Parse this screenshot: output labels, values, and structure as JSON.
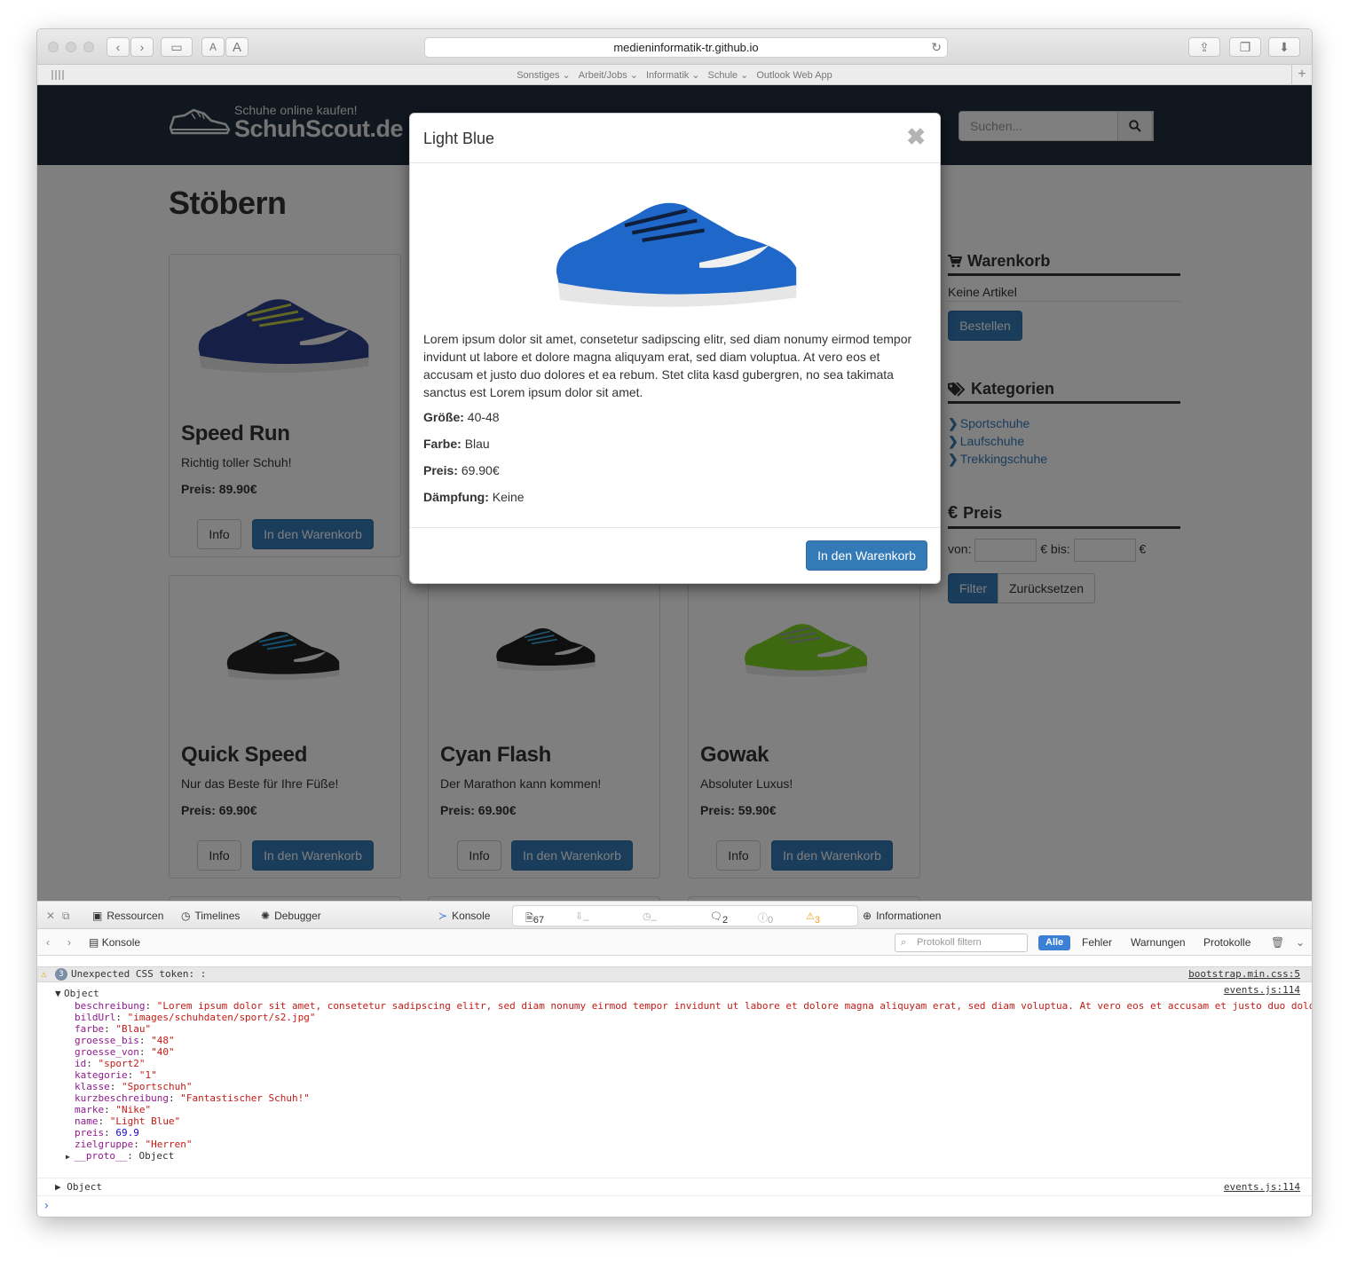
{
  "browser": {
    "url": "medieninformatik-tr.github.io",
    "favorites": [
      "Sonstiges",
      "Arbeit/Jobs",
      "Informatik",
      "Schule",
      "Outlook Web App"
    ],
    "tb_a_small": "A",
    "tb_a_large": "A"
  },
  "site": {
    "tagline": "Schuhe online kaufen!",
    "brand": "SchuhScout.de",
    "search_placeholder": "Suchen...",
    "heading": "Stöbern",
    "info_label": "Info",
    "cart_label": "In den Warenkorb",
    "products": [
      {
        "name": "Speed Run",
        "sub": "Richtig toller Schuh!",
        "price": "Preis: 89.90€",
        "color": "#2c3f8a"
      },
      {
        "name": "Quick Speed",
        "sub": "Nur das Beste für Ihre Füße!",
        "price": "Preis: 69.90€",
        "color": "#222222"
      },
      {
        "name": "Cyan Flash",
        "sub": "Der Marathon kann kommen!",
        "price": "Preis: 69.90€",
        "color": "#1f1f1f"
      },
      {
        "name": "Gowak",
        "sub": "Absoluter Luxus!",
        "price": "Preis: 59.90€",
        "color": "#7ed321"
      }
    ],
    "sidebar": {
      "cart_title": "Warenkorb",
      "cart_empty": "Keine Artikel",
      "order_button": "Bestellen",
      "categories_title": "Kategorien",
      "categories": [
        "Sportschuhe",
        "Laufschuhe",
        "Trekkingschuhe"
      ],
      "price_title": "Preis",
      "from_label": "von:",
      "to_label": "€ bis:",
      "euro": "€",
      "filter_button": "Filter",
      "reset_button": "Zurücksetzen"
    }
  },
  "modal": {
    "title": "Light Blue",
    "description": "Lorem ipsum dolor sit amet, consetetur sadipscing elitr, sed diam nonumy eirmod tempor invidunt ut labore et dolore magna aliquyam erat, sed diam voluptua. At vero eos et accusam et justo duo dolores et ea rebum. Stet clita kasd gubergren, no sea takimata sanctus est Lorem ipsum dolor sit amet.",
    "size_label": "Größe:",
    "size_value": "40-48",
    "color_label": "Farbe:",
    "color_value": "Blau",
    "price_label": "Preis:",
    "price_value": "69.90€",
    "damping_label": "Dämpfung:",
    "damping_value": "Keine",
    "cart_button": "In den Warenkorb"
  },
  "devtools": {
    "tabs": [
      "Ressourcen",
      "Timelines",
      "Debugger",
      "Konsole",
      "Informationen"
    ],
    "counts": {
      "resources": "67",
      "net": "–",
      "time": "–",
      "logs": "2",
      "errors": "0",
      "warnings": "3"
    },
    "breadcrumb": "Konsole",
    "filter_placeholder": "Protokoll filtern",
    "filters": [
      "Alle",
      "Fehler",
      "Warnungen",
      "Protokolle"
    ],
    "warning_count": "3",
    "warning_text": "Unexpected CSS token: :",
    "warning_src": "bootstrap.min.css:5",
    "obj_src": "events.js:114",
    "obj_label": "Object",
    "props": [
      {
        "k": "beschreibung",
        "v": "\"Lorem ipsum dolor sit amet, consetetur sadipscing elitr, sed diam nonumy eirmod tempor invidunt ut labore et dolore magna aliquyam erat, sed diam voluptua. At vero eos et accusam et justo duo dolo",
        "t": "str"
      },
      {
        "k": "bildUrl",
        "v": "\"images/schuhdaten/sport/s2.jpg\"",
        "t": "str"
      },
      {
        "k": "farbe",
        "v": "\"Blau\"",
        "t": "str"
      },
      {
        "k": "groesse_bis",
        "v": "\"48\"",
        "t": "str"
      },
      {
        "k": "groesse_von",
        "v": "\"40\"",
        "t": "str"
      },
      {
        "k": "id",
        "v": "\"sport2\"",
        "t": "str"
      },
      {
        "k": "kategorie",
        "v": "\"1\"",
        "t": "str"
      },
      {
        "k": "klasse",
        "v": "\"Sportschuh\"",
        "t": "str"
      },
      {
        "k": "kurzbeschreibung",
        "v": "\"Fantastischer Schuh!\"",
        "t": "str"
      },
      {
        "k": "marke",
        "v": "\"Nike\"",
        "t": "str"
      },
      {
        "k": "name",
        "v": "\"Light Blue\"",
        "t": "str"
      },
      {
        "k": "preis",
        "v": "69.9",
        "t": "num"
      },
      {
        "k": "zielgruppe",
        "v": "\"Herren\"",
        "t": "str"
      },
      {
        "k": "__proto__",
        "v": "Object",
        "t": "obj"
      }
    ],
    "obj2_label": "Object",
    "obj2_src": "events.js:114",
    "prompt": "›"
  }
}
